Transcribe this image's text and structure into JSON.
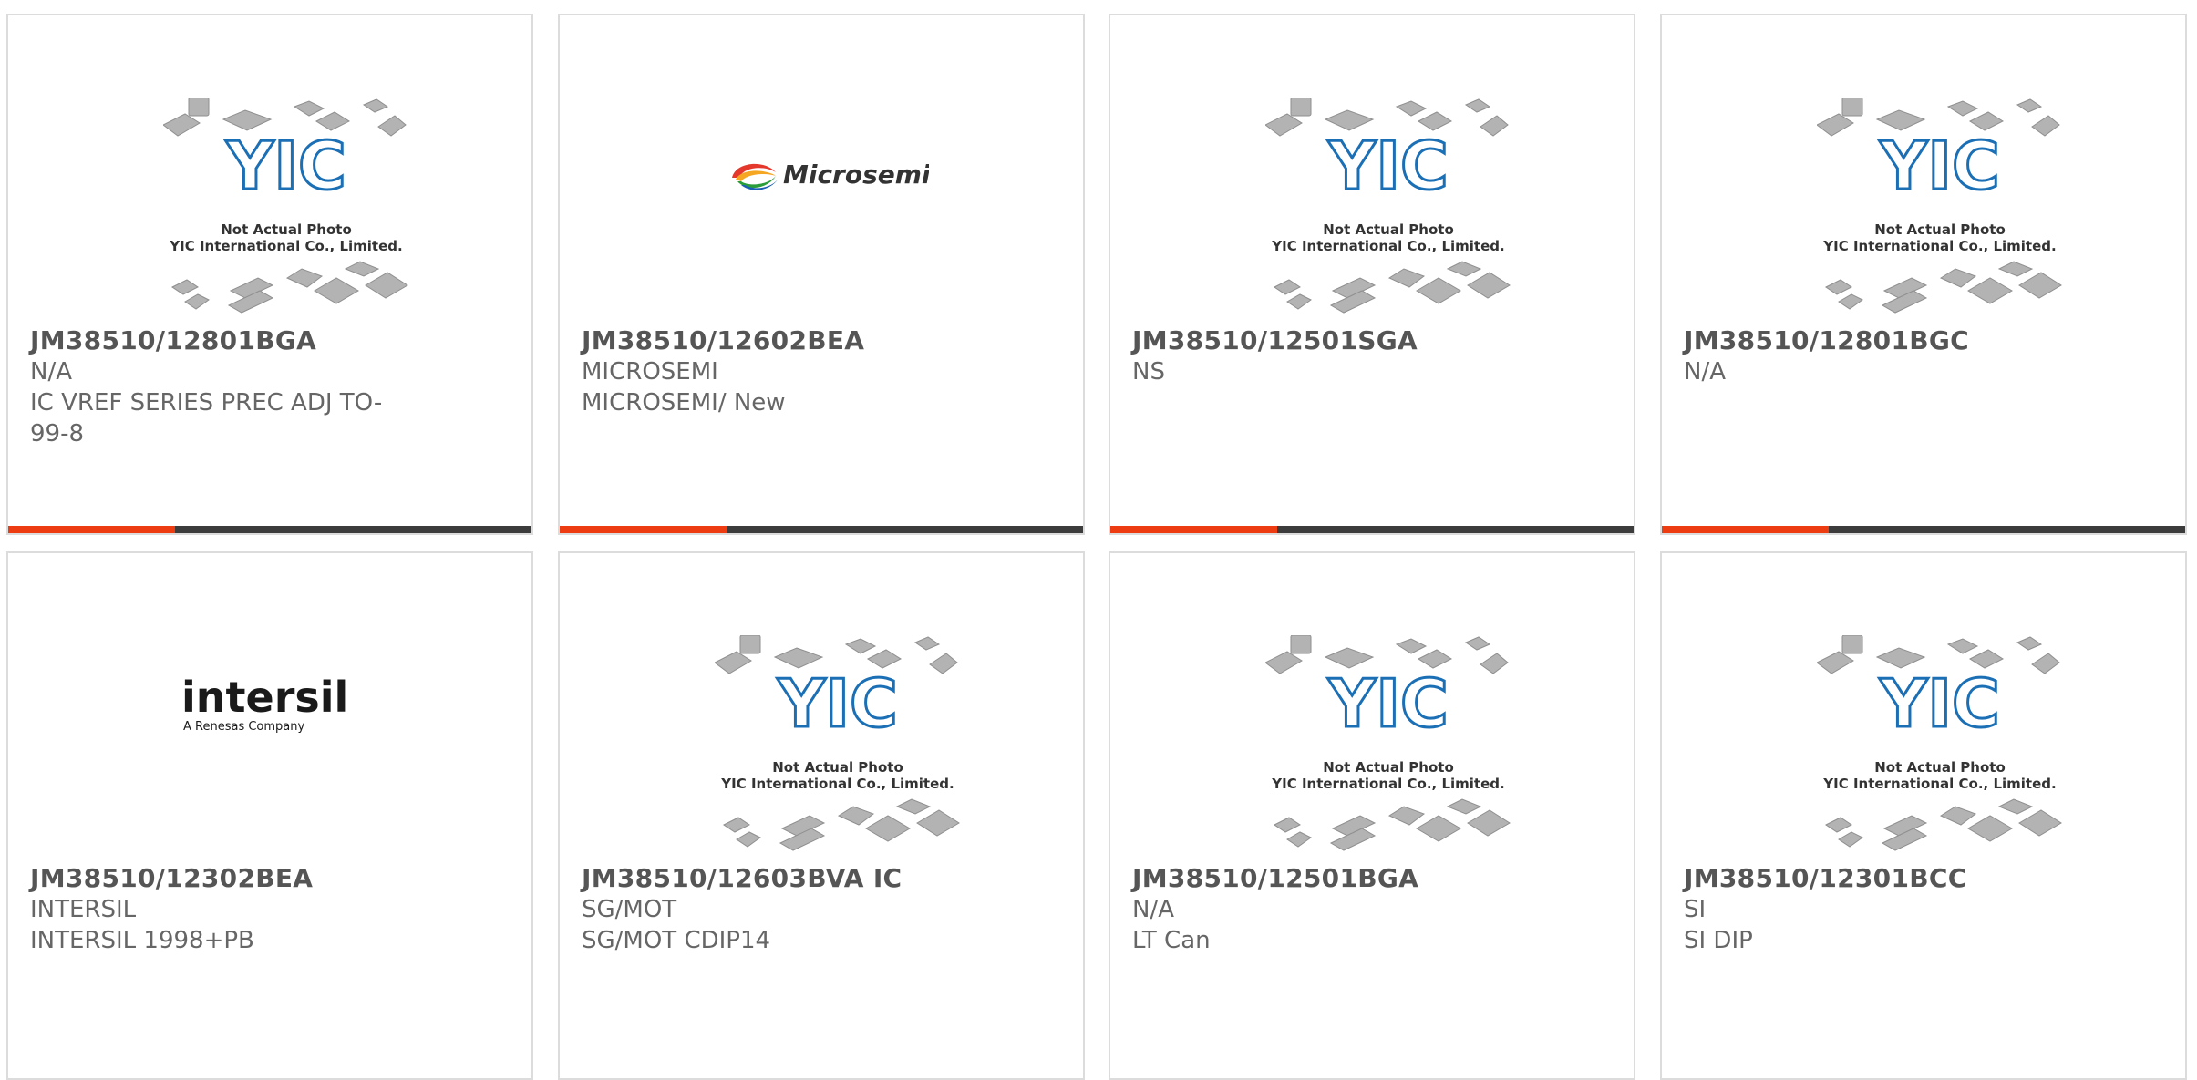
{
  "placeholder": {
    "line1": "Not Actual Photo",
    "line2": "YIC International Co., Limited.",
    "logo_text": "YIC"
  },
  "brands": {
    "microsemi": "Microsemi",
    "intersil": "intersil",
    "intersil_tagline": "A Renesas Company"
  },
  "colors": {
    "accent": "#ed3b12",
    "bar": "#3c3c3c",
    "text": "#666666",
    "yic_blue": "#1b6fb5"
  },
  "products": [
    {
      "part": "JM38510/12801BGA",
      "maker": "N/A",
      "desc": "IC VREF SERIES PREC ADJ TO-99-8",
      "image": "placeholder"
    },
    {
      "part": "JM38510/12602BEA",
      "maker": "MICROSEMI",
      "desc": "MICROSEMI/ New",
      "image": "microsemi-logo"
    },
    {
      "part": "JM38510/12501SGA",
      "maker": "NS",
      "desc": "",
      "image": "placeholder"
    },
    {
      "part": "JM38510/12801BGC",
      "maker": "N/A",
      "desc": "",
      "image": "placeholder"
    },
    {
      "part": "JM38510/12302BEA",
      "maker": "INTERSIL",
      "desc": "INTERSIL 1998+PB",
      "image": "intersil-logo"
    },
    {
      "part": "JM38510/12603BVA IC",
      "maker": "SG/MOT",
      "desc": "SG/MOT CDIP14",
      "image": "placeholder"
    },
    {
      "part": "JM38510/12501BGA",
      "maker": "N/A",
      "desc": "LT Can",
      "image": "placeholder"
    },
    {
      "part": "JM38510/12301BCC",
      "maker": "SI",
      "desc": "SI DIP",
      "image": "placeholder"
    }
  ]
}
